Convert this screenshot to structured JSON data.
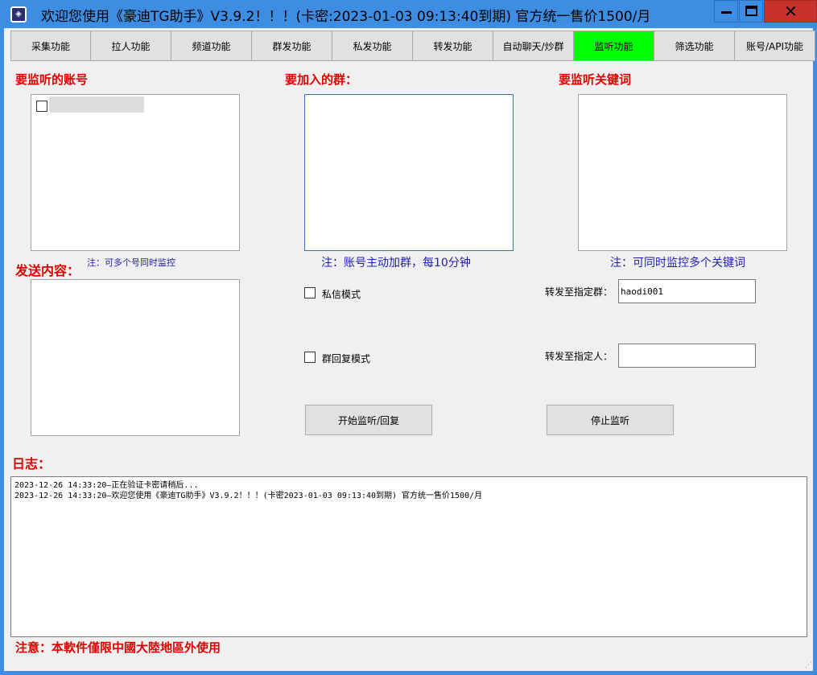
{
  "window": {
    "title": "欢迎您使用《豪迪TG助手》V3.9.2！！！(卡密:2023-01-03 09:13:40到期) 官方统一售价1500/月",
    "icon": "app-icon",
    "minimize": "minimize-icon",
    "maximize": "maximize-icon",
    "close": "close-icon",
    "close_glyph": "✕",
    "accent_color": "#3d8ee3"
  },
  "tabs": [
    {
      "label": "采集功能",
      "active": false
    },
    {
      "label": "拉人功能",
      "active": false
    },
    {
      "label": "频道功能",
      "active": false
    },
    {
      "label": "群发功能",
      "active": false
    },
    {
      "label": "私发功能",
      "active": false
    },
    {
      "label": "转发功能",
      "active": false
    },
    {
      "label": "自动聊天/炒群",
      "active": false
    },
    {
      "label": "监听功能",
      "active": true
    },
    {
      "label": "筛选功能",
      "active": false
    },
    {
      "label": "账号/API功能",
      "active": false
    }
  ],
  "monitor": {
    "accounts_label": "要监听的账号",
    "groups_label": "要加入的群：",
    "keywords_label": "要监听关键词",
    "accounts_note": "注：可多个号同时监控",
    "groups_note": "注：账号主动加群，每10分钟",
    "keywords_note": "注：可同时监控多个关键词",
    "send_content_label": "发送内容：",
    "private_mode_label": "私信模式",
    "group_reply_mode_label": "群回复模式",
    "forward_group_label": "转发至指定群：",
    "forward_group_value": "haodi001",
    "forward_person_label": "转发至指定人：",
    "forward_person_value": "",
    "start_button": "开始监听/回复",
    "stop_button": "停止监听"
  },
  "log": {
    "label": "日志：",
    "lines": [
      "2023-12-26 14:33:20—正在验证卡密请稍后...",
      "2023-12-26 14:33:20—欢迎您使用《豪迪TG助手》V3.9.2！！！(卡密2023-01-03 09:13:40到期) 官方统一售价1500/月"
    ]
  },
  "footer": {
    "notice": "注意：本軟件僅限中國大陸地區外使用"
  },
  "colors": {
    "active_tab": "#00ff00",
    "label_red": "#e00000",
    "note_blue": "#1f1fb0"
  }
}
